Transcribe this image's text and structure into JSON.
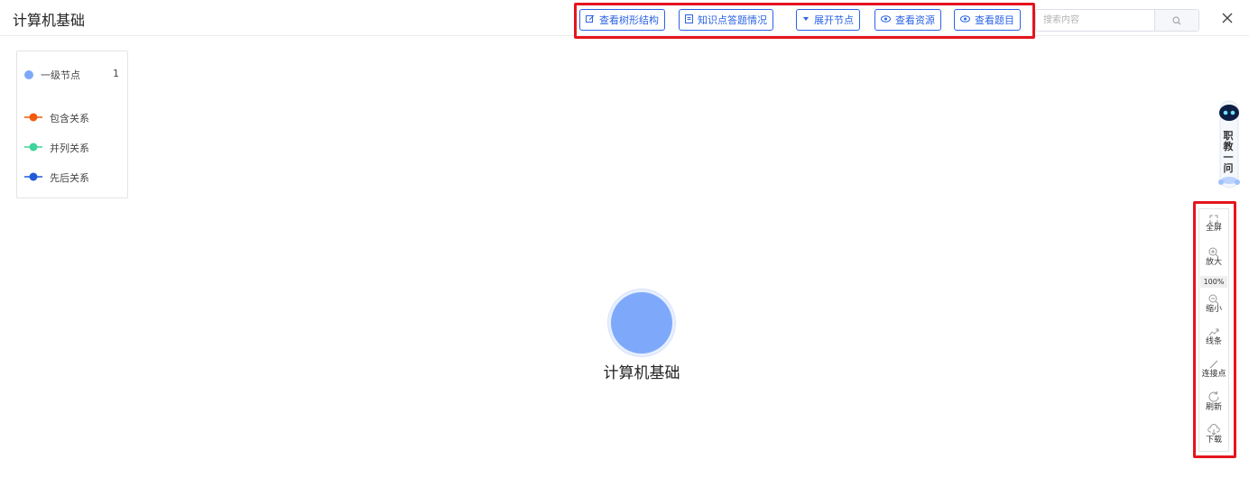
{
  "header": {
    "title": "计算机基础",
    "buttons": {
      "tree": "查看树形结构",
      "answers": "知识点答题情况",
      "expand": "展开节点",
      "resources": "查看资源",
      "questions": "查看题目"
    },
    "search": {
      "placeholder": "搜索内容",
      "value": ""
    }
  },
  "legend": {
    "nodes": [
      {
        "label": "一级节点",
        "count": "1",
        "color": "#7ea9fb"
      }
    ],
    "relations": [
      {
        "label": "包含关系",
        "color": "#f25b0f"
      },
      {
        "label": "并列关系",
        "color": "#3fd49a"
      },
      {
        "label": "先后关系",
        "color": "#1f5bd8"
      }
    ]
  },
  "graph": {
    "root": {
      "label": "计算机基础",
      "color": "#7ea9fb"
    }
  },
  "assistant": {
    "label": "职教一问"
  },
  "toolbar": {
    "fullscreen": "全屏",
    "zoom_in": "放大",
    "zoom_level": "100%",
    "zoom_out": "缩小",
    "lines": "线条",
    "connect": "连接点",
    "refresh": "刷新",
    "download": "下载"
  },
  "colors": {
    "accent": "#2b63e6",
    "highlight": "#e6141e"
  }
}
